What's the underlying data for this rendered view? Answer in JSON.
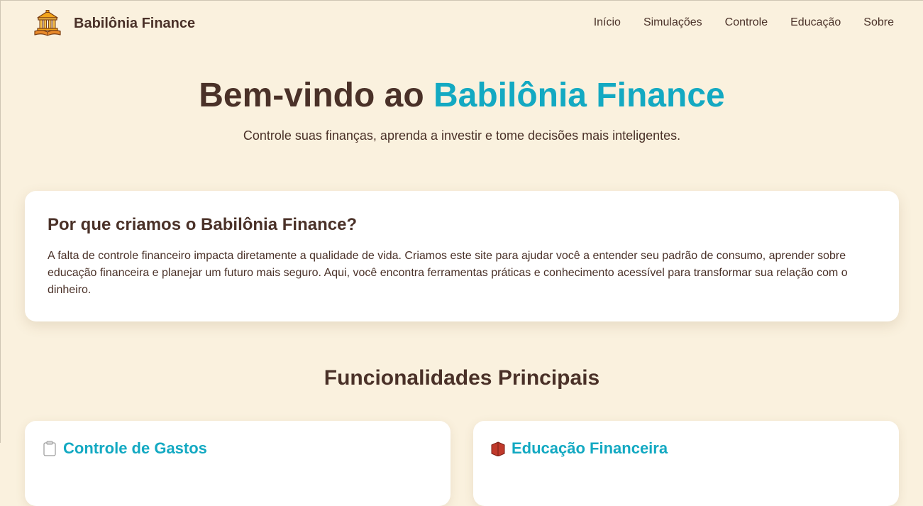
{
  "brand": {
    "name": "Babilônia Finance",
    "logo_icon": "temple-icon"
  },
  "nav": {
    "items": [
      {
        "label": "Início"
      },
      {
        "label": "Simulações"
      },
      {
        "label": "Controle"
      },
      {
        "label": "Educação"
      },
      {
        "label": "Sobre"
      }
    ]
  },
  "hero": {
    "title_prefix": "Bem-vindo ao ",
    "title_accent": "Babilônia Finance",
    "subtitle": "Controle suas finanças, aprenda a investir e tome decisões mais inteligentes."
  },
  "about": {
    "title": "Por que criamos o Babilônia Finance?",
    "text": "A falta de controle financeiro impacta diretamente a qualidade de vida. Criamos este site para ajudar você a entender seu padrão de consumo, aprender sobre educação financeira e planejar um futuro mais seguro. Aqui, você encontra ferramentas práticas e conhecimento acessível para transformar sua relação com o dinheiro."
  },
  "features": {
    "title": "Funcionalidades Principais",
    "cards": [
      {
        "title": "Controle de Gastos",
        "icon": "clipboard-icon"
      },
      {
        "title": "Educação Financeira",
        "icon": "book-icon"
      }
    ]
  },
  "colors": {
    "background": "#faf1de",
    "text": "#4a3128",
    "accent": "#13a9c2",
    "card": "#ffffff"
  }
}
